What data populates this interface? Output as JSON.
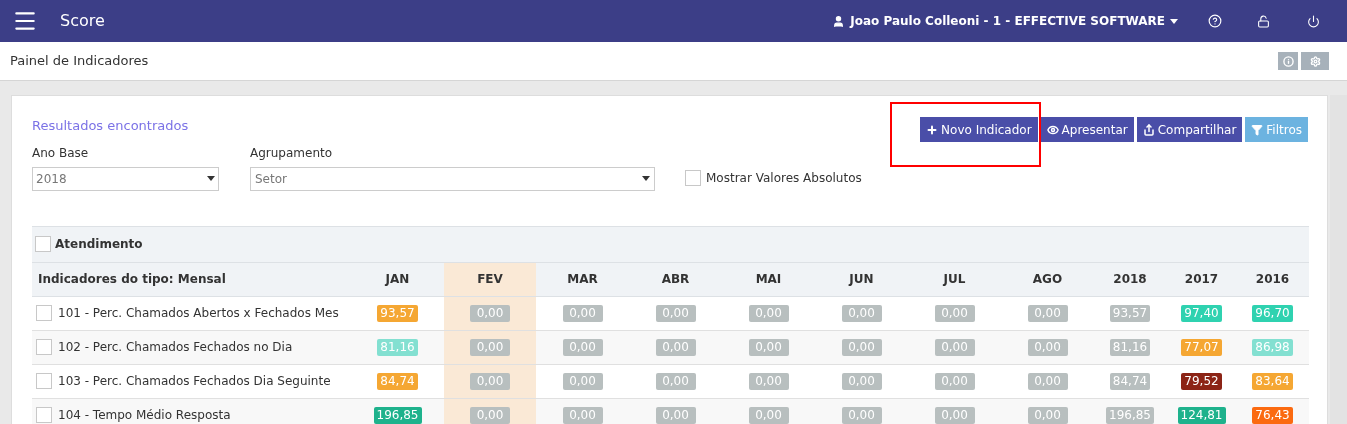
{
  "app_bar": {
    "title": "Score",
    "user": "Joao Paulo Colleoni - 1 - EFFECTIVE SOFTWARE"
  },
  "page_title": "Painel de Indicadores",
  "results_title": "Resultados encontrados",
  "actions": [
    {
      "label": "Novo Indicador",
      "kind": "primary"
    },
    {
      "label": "Apresentar",
      "kind": "primary"
    },
    {
      "label": "Compartilhar",
      "kind": "primary"
    },
    {
      "label": "Filtros",
      "kind": "info"
    }
  ],
  "filters": {
    "ano_base": {
      "label": "Ano Base",
      "value": "2018"
    },
    "agrupamento": {
      "label": "Agrupamento",
      "value": "Setor"
    },
    "absolutos": {
      "label": "Mostrar Valores Absolutos",
      "checked": false
    }
  },
  "group": {
    "label": "Atendimento",
    "checked": false
  },
  "table": {
    "columns": [
      {
        "label": "Indicadores do tipo: Mensal",
        "highlighted": false
      },
      {
        "label": "JAN",
        "highlighted": false
      },
      {
        "label": "FEV",
        "highlighted": true
      },
      {
        "label": "MAR",
        "highlighted": false
      },
      {
        "label": "ABR",
        "highlighted": false
      },
      {
        "label": "MAI",
        "highlighted": false
      },
      {
        "label": "JUN",
        "highlighted": false
      },
      {
        "label": "JUL",
        "highlighted": false
      },
      {
        "label": "AGO",
        "highlighted": false
      },
      {
        "label": "2018",
        "highlighted": false
      },
      {
        "label": "2017",
        "highlighted": false
      },
      {
        "label": "2016",
        "highlighted": false
      }
    ],
    "rows": [
      {
        "cells": [
          {
            "value": "101 - Perc. Chamados Abertos x Fechados Mes",
            "checked": false
          },
          {
            "value": "93,57",
            "color": "#f5a733"
          },
          {
            "value": "0,00",
            "color": "#b8bfbf"
          },
          {
            "value": "0,00",
            "color": "#b8bfbf"
          },
          {
            "value": "0,00",
            "color": "#b8bfbf"
          },
          {
            "value": "0,00",
            "color": "#b8bfbf"
          },
          {
            "value": "0,00",
            "color": "#b8bfbf"
          },
          {
            "value": "0,00",
            "color": "#b8bfbf"
          },
          {
            "value": "0,00",
            "color": "#b8bfbf"
          },
          {
            "value": "93,57",
            "color": "#b8bfbf"
          },
          {
            "value": "97,40",
            "color": "#2fd2b0"
          },
          {
            "value": "96,70",
            "color": "#2fd2b0"
          }
        ]
      },
      {
        "cells": [
          {
            "value": "102 - Perc. Chamados Fechados no Dia",
            "checked": false
          },
          {
            "value": "81,16",
            "color": "#83e0d1"
          },
          {
            "value": "0,00",
            "color": "#b8bfbf"
          },
          {
            "value": "0,00",
            "color": "#b8bfbf"
          },
          {
            "value": "0,00",
            "color": "#b8bfbf"
          },
          {
            "value": "0,00",
            "color": "#b8bfbf"
          },
          {
            "value": "0,00",
            "color": "#b8bfbf"
          },
          {
            "value": "0,00",
            "color": "#b8bfbf"
          },
          {
            "value": "0,00",
            "color": "#b8bfbf"
          },
          {
            "value": "81,16",
            "color": "#b8bfbf"
          },
          {
            "value": "77,07",
            "color": "#f5a733"
          },
          {
            "value": "86,98",
            "color": "#83e0d1"
          }
        ]
      },
      {
        "cells": [
          {
            "value": "103 - Perc. Chamados Fechados Dia Seguinte",
            "checked": false
          },
          {
            "value": "84,74",
            "color": "#f5a733"
          },
          {
            "value": "0,00",
            "color": "#b8bfbf"
          },
          {
            "value": "0,00",
            "color": "#b8bfbf"
          },
          {
            "value": "0,00",
            "color": "#b8bfbf"
          },
          {
            "value": "0,00",
            "color": "#b8bfbf"
          },
          {
            "value": "0,00",
            "color": "#b8bfbf"
          },
          {
            "value": "0,00",
            "color": "#b8bfbf"
          },
          {
            "value": "0,00",
            "color": "#b8bfbf"
          },
          {
            "value": "84,74",
            "color": "#b8bfbf"
          },
          {
            "value": "79,52",
            "color": "#8c2416"
          },
          {
            "value": "83,64",
            "color": "#f5a733"
          }
        ]
      },
      {
        "cells": [
          {
            "value": "104 - Tempo Médio Resposta",
            "checked": false
          },
          {
            "value": "196,85",
            "color": "#1eb28c"
          },
          {
            "value": "0,00",
            "color": "#b8bfbf"
          },
          {
            "value": "0,00",
            "color": "#b8bfbf"
          },
          {
            "value": "0,00",
            "color": "#b8bfbf"
          },
          {
            "value": "0,00",
            "color": "#b8bfbf"
          },
          {
            "value": "0,00",
            "color": "#b8bfbf"
          },
          {
            "value": "0,00",
            "color": "#b8bfbf"
          },
          {
            "value": "0,00",
            "color": "#b8bfbf"
          },
          {
            "value": "196,85",
            "color": "#b8bfbf"
          },
          {
            "value": "124,81",
            "color": "#1eb28c"
          },
          {
            "value": "76,43",
            "color": "#fb6a10"
          }
        ]
      }
    ]
  }
}
